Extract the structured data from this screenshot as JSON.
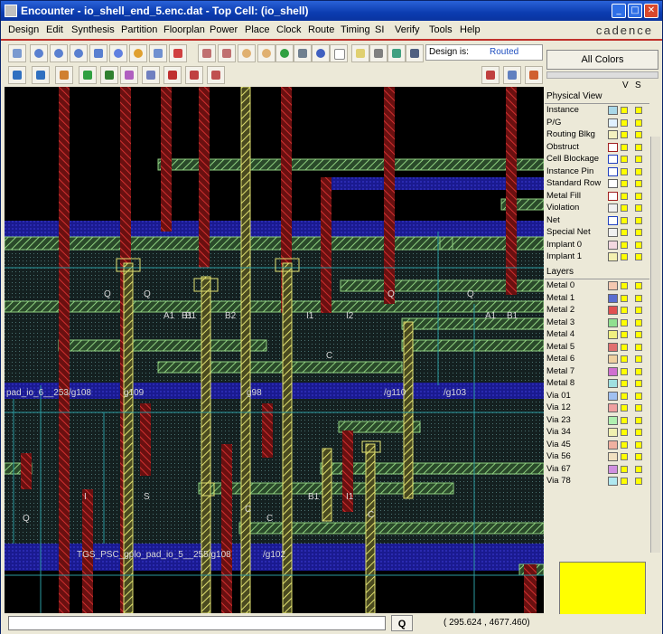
{
  "window": {
    "title": "Encounter - io_shell_end_5.enc.dat - Top Cell: (io_shell)"
  },
  "menu": [
    "Design",
    "Edit",
    "Synthesis",
    "Partition",
    "Floorplan",
    "Power",
    "Place",
    "Clock",
    "Route",
    "Timing",
    "SI",
    "Verify",
    "Tools",
    "Help"
  ],
  "brand": "cadence",
  "design_status": {
    "label": "Design is:",
    "value": "Routed"
  },
  "right_panel": {
    "all_colors": "All Colors",
    "v_header": "V",
    "s_header": "S",
    "physical_view_header": "Physical View",
    "physical": [
      {
        "name": "Instance",
        "color": "#a9d8e8"
      },
      {
        "name": "P/G",
        "color": "#e0f0ff"
      },
      {
        "name": "Routing Blkg",
        "color": "#f3f0c0"
      },
      {
        "name": "Obstruct",
        "color": "#ffffff",
        "border": "#a02020"
      },
      {
        "name": "Cell Blockage",
        "color": "#ffffff",
        "border": "#2040c0"
      },
      {
        "name": "Instance Pin",
        "color": "#ffffff",
        "border": "#2040c0"
      },
      {
        "name": "Standard Row",
        "color": "#ffffff",
        "border": "#606060"
      },
      {
        "name": "Metal Fill",
        "color": "#ffffff",
        "border": "#a02020"
      },
      {
        "name": "Violation",
        "color": "#f0f0f0"
      },
      {
        "name": "Net",
        "color": "#ffffff",
        "border": "#2040c0"
      },
      {
        "name": "Special Net",
        "color": "#f0f0f0"
      },
      {
        "name": "Implant 0",
        "color": "#f3d8e0"
      },
      {
        "name": "Implant 1",
        "color": "#f3f0b0"
      }
    ],
    "layers_header": "Layers",
    "layers": [
      {
        "name": "Metal 0",
        "color": "#f4c8b0"
      },
      {
        "name": "Metal 1",
        "color": "#5a6ed0"
      },
      {
        "name": "Metal 2",
        "color": "#e05050"
      },
      {
        "name": "Metal 3",
        "color": "#90e090"
      },
      {
        "name": "Metal 4",
        "color": "#f0f080"
      },
      {
        "name": "Metal 5",
        "color": "#e07070"
      },
      {
        "name": "Metal 6",
        "color": "#f0d0a0"
      },
      {
        "name": "Metal 7",
        "color": "#d070d0"
      },
      {
        "name": "Metal 8",
        "color": "#a0e0e0"
      },
      {
        "name": "Via 01",
        "color": "#a0c0f0"
      },
      {
        "name": "Via 12",
        "color": "#f0a0a0"
      },
      {
        "name": "Via 23",
        "color": "#b0f0b0"
      },
      {
        "name": "Via 34",
        "color": "#f0f0b0"
      },
      {
        "name": "Via 45",
        "color": "#f0b0a0"
      },
      {
        "name": "Via 56",
        "color": "#f0e0c0"
      },
      {
        "name": "Via 67",
        "color": "#d090e0"
      },
      {
        "name": "Via 78",
        "color": "#b0e8f0"
      }
    ]
  },
  "canvas": {
    "labels": [
      "pad_io_6__253/g108",
      "g109",
      "g98",
      "/g110",
      "/g103",
      "TGS_PSC_gplo_pad_io_5__255/g108",
      "/g102",
      "Q",
      "Q",
      "Q",
      "Q",
      "A1",
      "B1",
      "B2",
      "B1",
      "I1",
      "A1",
      "B1",
      "C",
      "S",
      "B1",
      "C",
      "Q",
      "I2",
      "I1",
      "C",
      "C",
      "I"
    ]
  },
  "status": {
    "command": "",
    "q_button": "Q",
    "coords": "(     295.624 ,    4677.460)"
  }
}
